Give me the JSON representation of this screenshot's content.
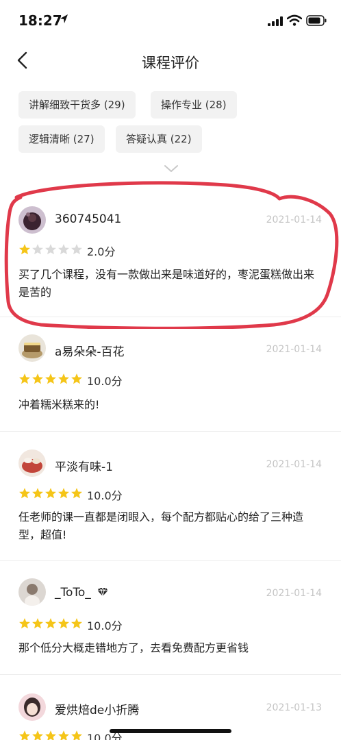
{
  "status_bar": {
    "time": "18:27"
  },
  "nav": {
    "title": "课程评价"
  },
  "tags": [
    {
      "label": "讲解细致干货多 (29)"
    },
    {
      "label": "操作专业 (28)"
    },
    {
      "label": "逻辑清晰 (27)"
    },
    {
      "label": "答疑认真 (22)"
    }
  ],
  "reviews": [
    {
      "username": "360745041",
      "date": "2021-01-14",
      "rating": 1,
      "score": "2.0分",
      "text": "买了几个课程，没有一款做出来是味道好的，枣泥蛋糕做出来是苦的"
    },
    {
      "username": "a易朵朵-百花",
      "date": "2021-01-14",
      "rating": 5,
      "score": "10.0分",
      "text": "冲着糯米糕来的!"
    },
    {
      "username": "平淡有味-1",
      "date": "2021-01-14",
      "rating": 5,
      "score": "10.0分",
      "text": "任老师的课一直都是闭眼入，每个配方都贴心的给了三种造型，超值!"
    },
    {
      "username": "_ToTo_",
      "date": "2021-01-14",
      "rating": 5,
      "score": "10.0分",
      "text": "那个低分大概走错地方了，去看免费配方更省钱"
    },
    {
      "username": "爱烘焙de小折腾",
      "date": "2021-01-13",
      "rating": 5,
      "score": "10.0分",
      "text": ""
    }
  ],
  "colors": {
    "star_filled": "#f5c518",
    "star_empty": "#d9d9d9",
    "annotation": "#e0394a"
  }
}
